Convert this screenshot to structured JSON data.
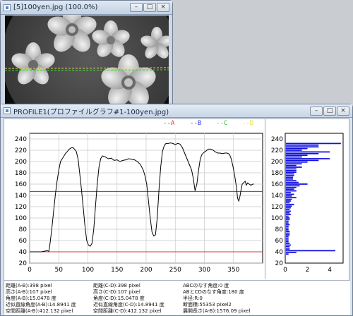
{
  "image_window": {
    "title": "[5]100yen.jpg (100.0%)",
    "controls": [
      "–",
      "□",
      "×"
    ]
  },
  "profile_window": {
    "title": "PROFILE1(プロファイルグラフ#1-100yen.jpg)",
    "controls": [
      "–",
      "□",
      "×"
    ]
  },
  "legend": {
    "a": "--A",
    "b": "--B",
    "c": "--C",
    "d": "--D"
  },
  "colors": {
    "line_a": "#e03030",
    "line_b": "#3a3ae0",
    "line_c": "#30c030",
    "line_d": "#e0e030",
    "histogram": "#1010e0",
    "profile": "#000000"
  },
  "chart_data": [
    {
      "type": "line",
      "xlim": [
        0,
        400
      ],
      "ylim": [
        20,
        250
      ],
      "x_ticks": [
        "0",
        "50",
        "100",
        "150",
        "200",
        "250",
        "300",
        "350"
      ],
      "y_ticks": [
        "20",
        "40",
        "60",
        "80",
        "100",
        "120",
        "140",
        "160",
        "180",
        "200",
        "220",
        "240"
      ],
      "grid": true,
      "reference_lines": [
        {
          "name": "A",
          "y": 40,
          "color": "#e03030"
        },
        {
          "name": "B",
          "y": 147,
          "color": "#3a3ae0"
        }
      ],
      "series": [
        {
          "points": [
            [
              0,
              40
            ],
            [
              10,
              40
            ],
            [
              20,
              40
            ],
            [
              30,
              42
            ],
            [
              33,
              41
            ],
            [
              35,
              55
            ],
            [
              38,
              80
            ],
            [
              41,
              110
            ],
            [
              44,
              140
            ],
            [
              47,
              165
            ],
            [
              50,
              185
            ],
            [
              53,
              200
            ],
            [
              56,
              205
            ],
            [
              59,
              210
            ],
            [
              62,
              215
            ],
            [
              65,
              218
            ],
            [
              68,
              222
            ],
            [
              71,
              224
            ],
            [
              74,
              225
            ],
            [
              77,
              222
            ],
            [
              80,
              218
            ],
            [
              83,
              205
            ],
            [
              86,
              178
            ],
            [
              89,
              150
            ],
            [
              92,
              118
            ],
            [
              95,
              85
            ],
            [
              98,
              60
            ],
            [
              101,
              52
            ],
            [
              104,
              50
            ],
            [
              107,
              55
            ],
            [
              110,
              80
            ],
            [
              113,
              120
            ],
            [
              116,
              160
            ],
            [
              119,
              190
            ],
            [
              122,
              205
            ],
            [
              125,
              210
            ],
            [
              130,
              208
            ],
            [
              135,
              205
            ],
            [
              140,
              206
            ],
            [
              145,
              202
            ],
            [
              150,
              203
            ],
            [
              155,
              200
            ],
            [
              160,
              202
            ],
            [
              165,
              203
            ],
            [
              170,
              205
            ],
            [
              175,
              204
            ],
            [
              180,
              203
            ],
            [
              185,
              200
            ],
            [
              190,
              195
            ],
            [
              195,
              185
            ],
            [
              198,
              175
            ],
            [
              201,
              160
            ],
            [
              204,
              130
            ],
            [
              207,
              100
            ],
            [
              210,
              75
            ],
            [
              213,
              68
            ],
            [
              216,
              70
            ],
            [
              219,
              100
            ],
            [
              222,
              150
            ],
            [
              225,
              190
            ],
            [
              228,
              218
            ],
            [
              231,
              228
            ],
            [
              234,
              232
            ],
            [
              238,
              232
            ],
            [
              242,
              233
            ],
            [
              246,
              232
            ],
            [
              250,
              230
            ],
            [
              254,
              232
            ],
            [
              258,
              231
            ],
            [
              262,
              225
            ],
            [
              266,
              215
            ],
            [
              270,
              205
            ],
            [
              274,
              195
            ],
            [
              278,
              185
            ],
            [
              281,
              170
            ],
            [
              284,
              148
            ],
            [
              287,
              160
            ],
            [
              290,
              185
            ],
            [
              293,
              205
            ],
            [
              296,
              213
            ],
            [
              299,
              216
            ],
            [
              303,
              219
            ],
            [
              307,
              222
            ],
            [
              311,
              222
            ],
            [
              315,
              220
            ],
            [
              319,
              217
            ],
            [
              323,
              215
            ],
            [
              327,
              215
            ],
            [
              331,
              214
            ],
            [
              335,
              215
            ],
            [
              339,
              215
            ],
            [
              343,
              213
            ],
            [
              346,
              205
            ],
            [
              349,
              192
            ],
            [
              352,
              175
            ],
            [
              355,
              155
            ],
            [
              357,
              135
            ],
            [
              359,
              130
            ],
            [
              361,
              138
            ],
            [
              363,
              150
            ],
            [
              365,
              160
            ],
            [
              367,
              162
            ],
            [
              370,
              165
            ],
            [
              372,
              158
            ],
            [
              374,
              162
            ],
            [
              377,
              160
            ],
            [
              380,
              158
            ],
            [
              383,
              160
            ],
            [
              385,
              160
            ]
          ]
        }
      ]
    },
    {
      "type": "bar",
      "orientation": "horizontal",
      "xlim": [
        0,
        5.2
      ],
      "ylim": [
        20,
        250
      ],
      "x_ticks": [
        "0",
        "2",
        "4"
      ],
      "y_ticks": [
        "20",
        "40",
        "60",
        "80",
        "100",
        "120",
        "140",
        "160",
        "180",
        "200",
        "220",
        "240"
      ],
      "bins": [
        [
          232,
          5
        ],
        [
          229,
          3
        ],
        [
          226,
          3
        ],
        [
          223,
          2
        ],
        [
          220,
          1.5
        ],
        [
          217,
          4
        ],
        [
          214,
          3
        ],
        [
          211,
          2
        ],
        [
          208,
          1.5
        ],
        [
          205,
          4
        ],
        [
          202,
          3
        ],
        [
          199,
          2
        ],
        [
          196,
          1.5
        ],
        [
          193,
          1
        ],
        [
          190,
          1.5
        ],
        [
          187,
          1
        ],
        [
          184,
          1
        ],
        [
          181,
          1
        ],
        [
          178,
          0.8
        ],
        [
          175,
          0.8
        ],
        [
          172,
          0.7
        ],
        [
          169,
          0.7
        ],
        [
          166,
          1
        ],
        [
          163,
          1.2
        ],
        [
          160,
          2
        ],
        [
          157,
          1.3
        ],
        [
          154,
          1
        ],
        [
          151,
          0.8
        ],
        [
          148,
          1
        ],
        [
          145,
          0.5
        ],
        [
          142,
          0.8
        ],
        [
          139,
          0.6
        ],
        [
          136,
          1
        ],
        [
          133,
          0.6
        ],
        [
          130,
          0.5
        ],
        [
          127,
          0.4
        ],
        [
          124,
          0.8
        ],
        [
          121,
          0.6
        ],
        [
          118,
          0.5
        ],
        [
          115,
          0.4
        ],
        [
          112,
          0.5
        ],
        [
          109,
          0.4
        ],
        [
          106,
          0.5
        ],
        [
          103,
          0.3
        ],
        [
          100,
          0.4
        ],
        [
          97,
          0.4
        ],
        [
          94,
          0.3
        ],
        [
          91,
          0.3
        ],
        [
          88,
          0.4
        ],
        [
          85,
          0.3
        ],
        [
          82,
          0.3
        ],
        [
          79,
          0.3
        ],
        [
          76,
          0.4
        ],
        [
          73,
          0.4
        ],
        [
          70,
          0.4
        ],
        [
          67,
          0.3
        ],
        [
          64,
          0.3
        ],
        [
          61,
          0.3
        ],
        [
          58,
          0.3
        ],
        [
          55,
          0.4
        ],
        [
          52,
          0.5
        ],
        [
          49,
          0.4
        ],
        [
          45,
          0.4
        ],
        [
          42,
          4.5
        ],
        [
          39,
          1
        ],
        [
          36,
          0.3
        ]
      ]
    }
  ],
  "info_rows": [
    [
      "距離(A-B):398 pixel",
      "距離(C-D):398 pixel",
      "ABCのなす角度:0 度"
    ],
    [
      "高さ(A-B):107 pixel",
      "高さ(C-D):107 pixel",
      "ABとCDのなす角度:180 度"
    ],
    [
      "角度(A-B):15.0478 度",
      "角度(C-D):15.0478 度",
      "半径:R:0"
    ],
    [
      "近似直線角度(A-B):14.8941 度",
      "近似直線角度(C-D):14.8941 度",
      "断面積:55353 pixel2"
    ],
    [
      "空間距離(A-B):412.132 pixel",
      "空間距離(C-D):412.132 pixel",
      "展開長さ(A-B):1576.09 pixel"
    ]
  ]
}
